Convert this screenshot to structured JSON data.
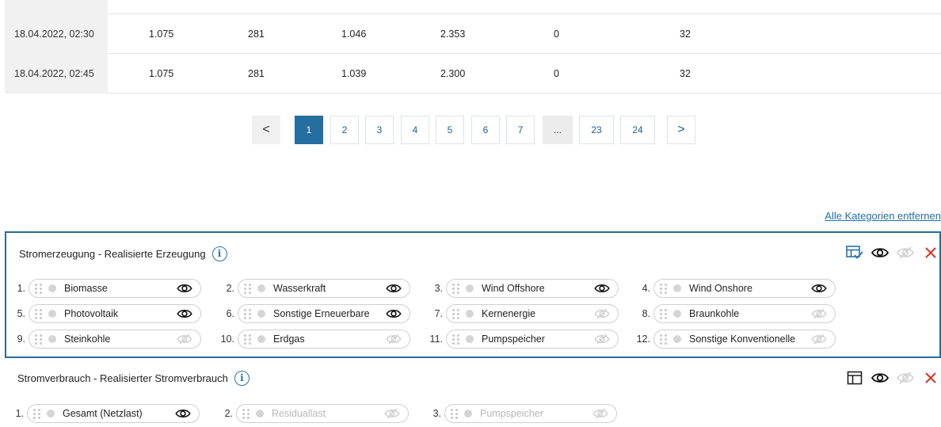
{
  "table": {
    "rows": [
      [
        "18.04.2022, 02:30",
        "1.075",
        "281",
        "1.046",
        "2.353",
        "0",
        "32"
      ],
      [
        "18.04.2022, 02:45",
        "1.075",
        "281",
        "1.039",
        "2.300",
        "0",
        "32"
      ]
    ]
  },
  "pagination": {
    "prev": "<",
    "pages": [
      "1",
      "2",
      "3",
      "4",
      "5",
      "6",
      "7",
      "...",
      "23",
      "24"
    ],
    "active": "1",
    "next": ">"
  },
  "remove_all_label": "Alle Kategorien entfernen",
  "categories": [
    {
      "title": "Stromerzeugung - Realisierte Erzeugung",
      "items": [
        {
          "num": "1.",
          "label": "Biomasse",
          "visible": true
        },
        {
          "num": "2.",
          "label": "Wasserkraft",
          "visible": true
        },
        {
          "num": "3.",
          "label": "Wind Offshore",
          "visible": true
        },
        {
          "num": "4.",
          "label": "Wind Onshore",
          "visible": true
        },
        {
          "num": "5.",
          "label": "Photovoltaik",
          "visible": true
        },
        {
          "num": "6.",
          "label": "Sonstige Erneuerbare",
          "visible": true
        },
        {
          "num": "7.",
          "label": "Kernenergie",
          "visible": false
        },
        {
          "num": "8.",
          "label": "Braunkohle",
          "visible": false
        },
        {
          "num": "9.",
          "label": "Steinkohle",
          "visible": false
        },
        {
          "num": "10.",
          "label": "Erdgas",
          "visible": false
        },
        {
          "num": "11.",
          "label": "Pumpspeicher",
          "visible": false
        },
        {
          "num": "12.",
          "label": "Sonstige Konventionelle",
          "visible": false
        }
      ]
    },
    {
      "title": "Stromverbrauch - Realisierter Stromverbrauch",
      "items": [
        {
          "num": "1.",
          "label": "Gesamt (Netzlast)",
          "visible": true,
          "disabled": false
        },
        {
          "num": "2.",
          "label": "Residuallast",
          "visible": false,
          "disabled": true
        },
        {
          "num": "3.",
          "label": "Pumpspeicher",
          "visible": false,
          "disabled": true
        }
      ]
    }
  ],
  "colors": {
    "accent": "#246f9f",
    "danger": "#d9352b",
    "link": "#1f6fa5"
  },
  "icons": {
    "visible": "eye-icon",
    "hidden": "eye-slash-icon",
    "remove": "close-icon",
    "table_check": "table-check-icon",
    "table": "table-icon",
    "info": "info-icon",
    "drag": "drag-handle-icon"
  }
}
